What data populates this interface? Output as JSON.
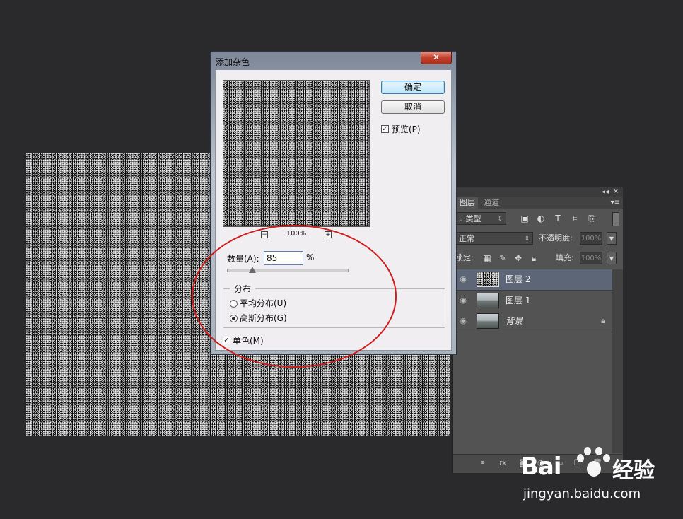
{
  "dialog": {
    "title": "添加杂色",
    "close_glyph": "✕",
    "ok_label": "确定",
    "cancel_label": "取消",
    "preview_label": "预览(P)",
    "preview_checked": true,
    "zoom_level": "100%",
    "zoom_out_glyph": "−",
    "zoom_in_glyph": "+",
    "amount_label": "数量(A):",
    "amount_value": "85",
    "amount_unit": "%",
    "distribution_label": "分布",
    "uniform_label": "平均分布(U)",
    "gaussian_label": "高斯分布(G)",
    "selected_distribution": "gaussian",
    "monochromatic_label": "单色(M)",
    "monochromatic_checked": true,
    "check_glyph": "✓"
  },
  "layers_panel": {
    "collapse_glyph": "◂◂",
    "close_glyph": "✕",
    "menu_glyph": "▾≡",
    "tabs": [
      "图层",
      "通道"
    ],
    "filter_kind": "类型",
    "blend_mode": "正常",
    "opacity_label": "不透明度:",
    "opacity_value": "100%",
    "lock_label": "锁定:",
    "fill_label": "填充:",
    "fill_value": "100%",
    "layers": [
      {
        "name": "图层 2",
        "selected": true,
        "thumb": "noise"
      },
      {
        "name": "图层 1",
        "selected": false,
        "thumb": "landscape"
      },
      {
        "name": "背景",
        "selected": false,
        "thumb": "landscape",
        "locked": true
      }
    ],
    "footer_fx": "fx"
  },
  "watermark": {
    "brand_left": "Bai",
    "brand_right": "经验",
    "url": "jingyan.baidu.com"
  },
  "colors": {
    "workspace": "#2a292c",
    "annotation": "#cf1c1c",
    "selected_layer": "#5d6677"
  }
}
